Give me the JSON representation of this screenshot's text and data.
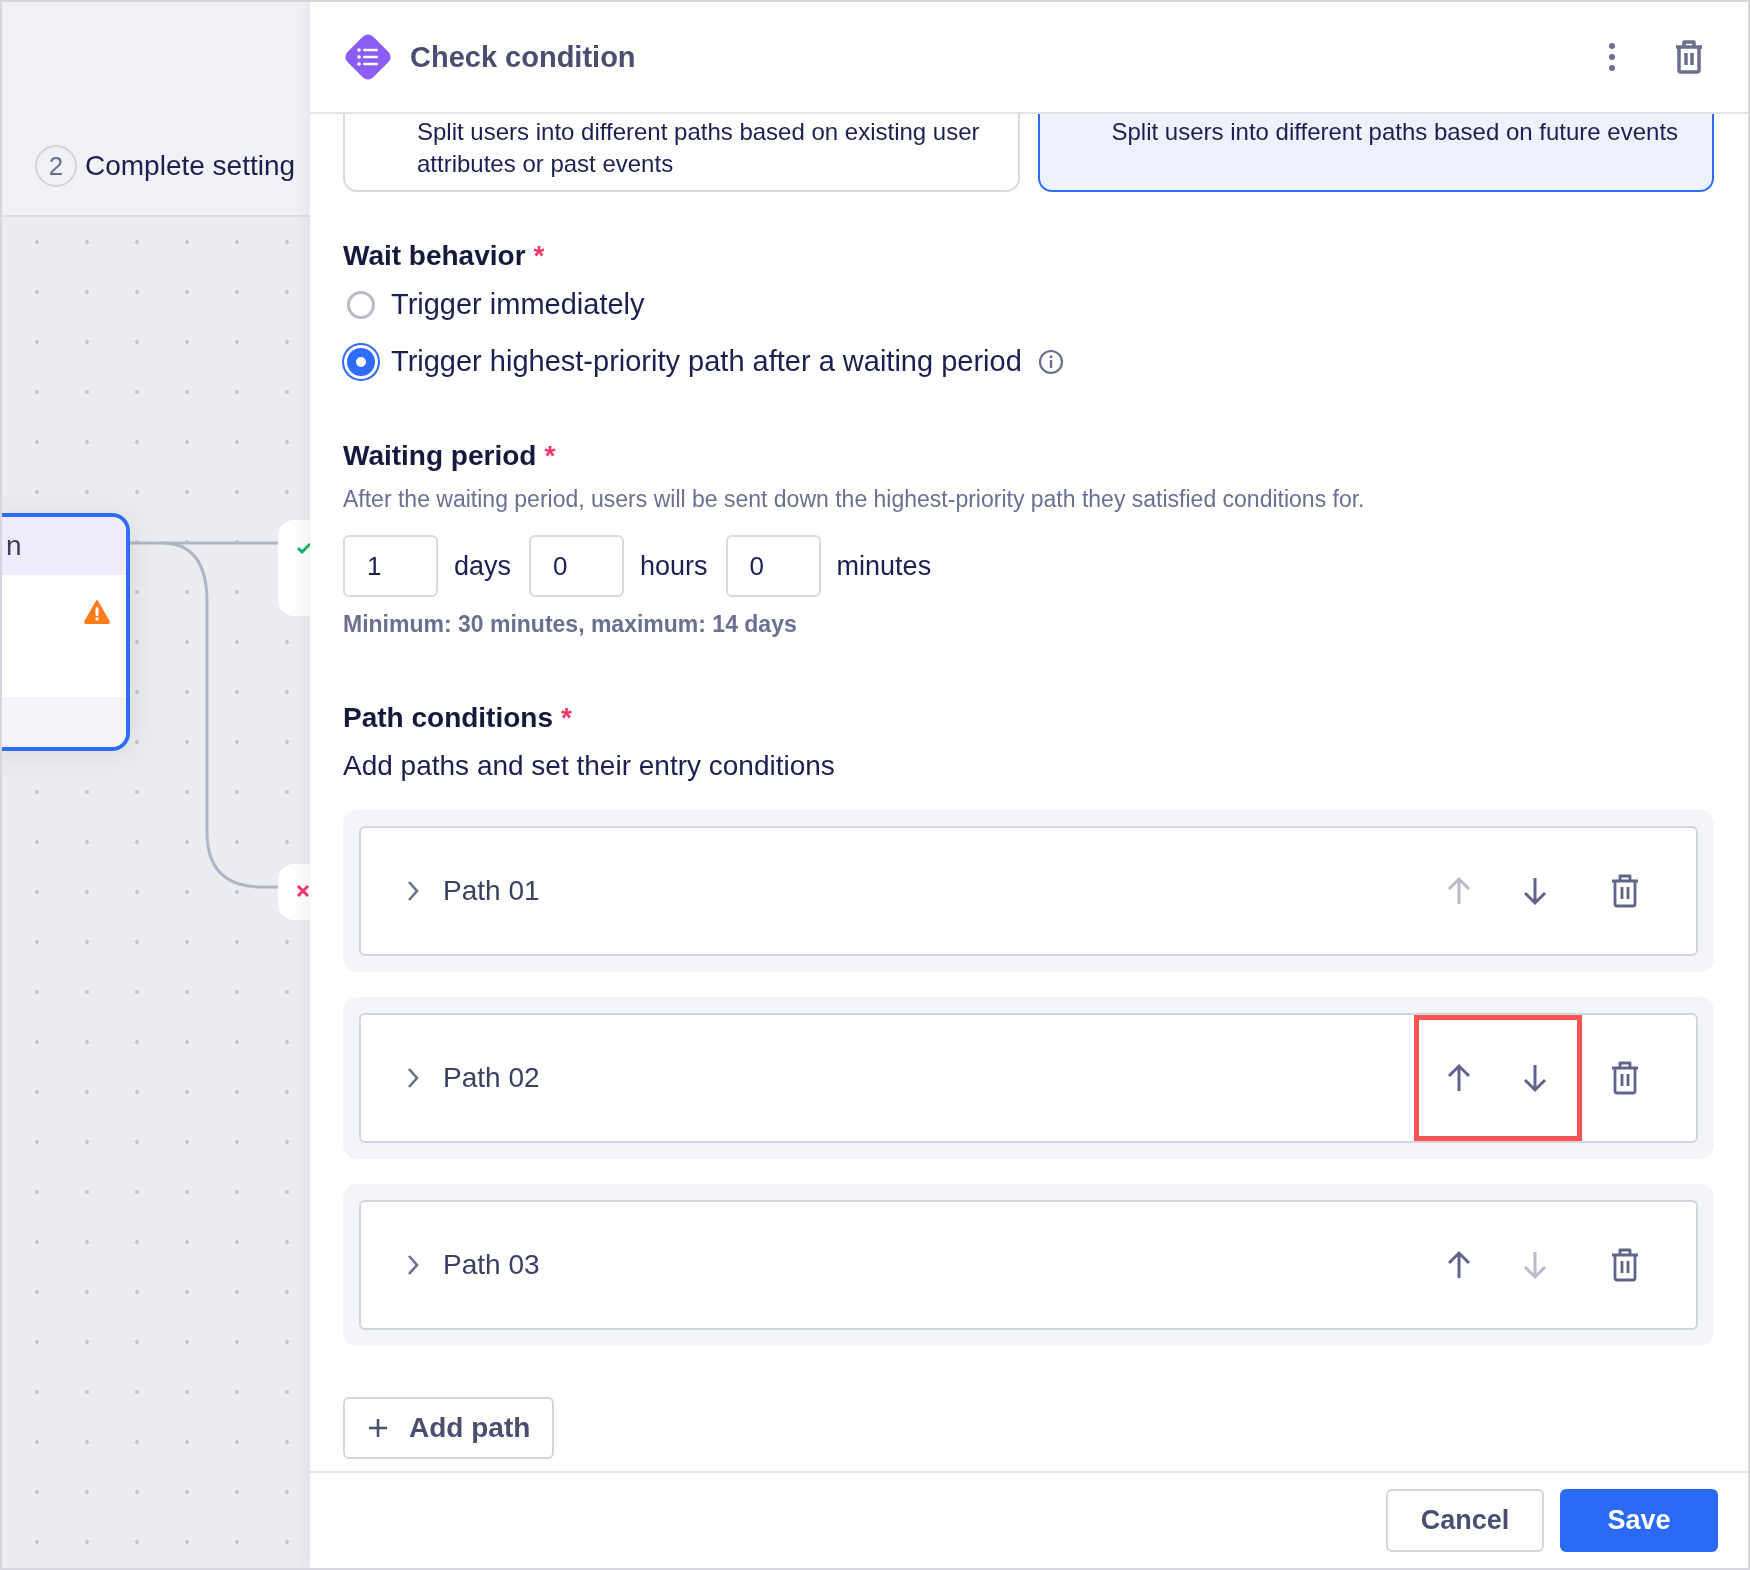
{
  "canvas": {
    "step_number": "2",
    "step_label": "Complete setting",
    "node_title": "n"
  },
  "panel": {
    "title": "Check condition"
  },
  "split_options": [
    {
      "description": "Split users into different paths based on existing user attributes or past events",
      "selected": false
    },
    {
      "description": "Split users into different paths based on future events",
      "selected": true
    }
  ],
  "wait_behavior": {
    "label": "Wait behavior",
    "mark": "*",
    "options": [
      {
        "label": "Trigger immediately",
        "selected": false,
        "info": false
      },
      {
        "label": "Trigger highest-priority path after a waiting period",
        "selected": true,
        "info": true
      }
    ]
  },
  "waiting_period": {
    "label": "Waiting period",
    "mark": "*",
    "description": "After the waiting period, users will be sent down the highest-priority path they satisfied conditions for.",
    "fields": [
      {
        "value": "1",
        "unit": "days"
      },
      {
        "value": "0",
        "unit": "hours"
      },
      {
        "value": "0",
        "unit": "minutes"
      }
    ],
    "hint": "Minimum: 30 minutes, maximum: 14 days"
  },
  "path_conditions": {
    "label": "Path conditions",
    "mark": "*",
    "description": "Add paths and set their entry conditions",
    "paths": [
      {
        "label": "Path 01",
        "up_disabled": true,
        "down_disabled": false,
        "highlighted": false
      },
      {
        "label": "Path 02",
        "up_disabled": false,
        "down_disabled": false,
        "highlighted": true
      },
      {
        "label": "Path 03",
        "up_disabled": false,
        "down_disabled": true,
        "highlighted": false
      }
    ],
    "add_label": "Add path"
  },
  "footer": {
    "cancel": "Cancel",
    "save": "Save"
  }
}
